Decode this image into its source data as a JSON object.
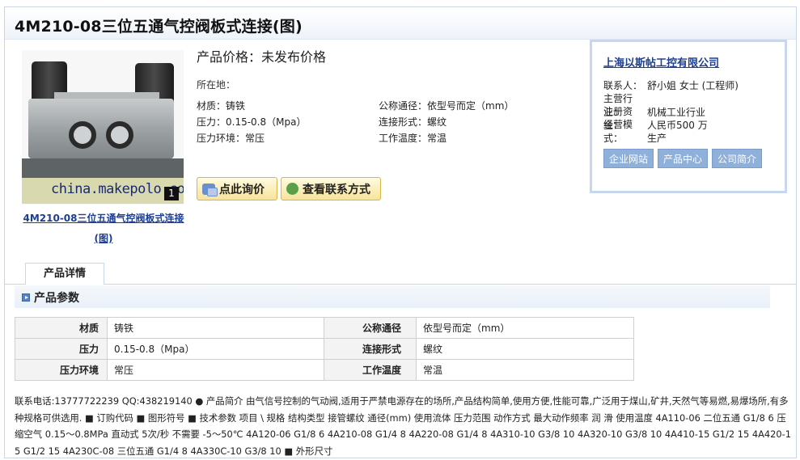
{
  "title": "4M210-08三位五通气控阀板式连接(图)",
  "image": {
    "watermark": "china.makepolo.com",
    "badge": "1",
    "caption": "4M210-08三位五通气控阀板式连接(图)"
  },
  "product": {
    "price_label": "产品价格：",
    "price_value": "未发布价格",
    "location": "所在地：",
    "specs": [
      {
        "label": "材质：铸铁"
      },
      {
        "label": "公称通径：依型号而定（mm）"
      },
      {
        "label": "压力：0.15-0.8（Mpa）"
      },
      {
        "label": "连接形式：螺纹"
      },
      {
        "label": "压力环境：常压"
      },
      {
        "label": "工作温度：常温"
      }
    ],
    "inquiry_button": "点此询价",
    "contact_button": "查看联系方式"
  },
  "company": {
    "name": "上海以斯帖工控有限公司",
    "rows": [
      {
        "key": "联系人：",
        "value": "舒小姐 女士 (工程师)"
      },
      {
        "key": "主营行业：",
        "value": "机械工业行业"
      },
      {
        "key": "注册资金：",
        "value": "人民币500 万"
      },
      {
        "key": "经营模式：",
        "value": "生产"
      }
    ],
    "buttons": [
      "企业网站",
      "产品中心",
      "公司简介"
    ]
  },
  "detail": {
    "tab": "产品详情",
    "section_title": "产品参数",
    "table": [
      [
        "材质",
        "铸铁",
        "公称通径",
        "依型号而定（mm）"
      ],
      [
        "压力",
        "0.15-0.8（Mpa）",
        "连接形式",
        "螺纹"
      ],
      [
        "压力环境",
        "常压",
        "工作温度",
        "常温"
      ]
    ],
    "description": "联系电话:13777722239 QQ:438219140 ● 产品简介 由气信号控制的气动阀,适用于严禁电源存在的场所,产品结构简单,使用方便,性能可靠,广泛用于煤山,矿井,天然气等易燃,易爆场所,有多种规格可供选用. ■ 订购代码 ■ 图形符号 ■ 技术参数 项目 \\ 规格 结构类型 接管螺纹 通径(mm) 使用流体 压力范围 动作方式 最大动作频率 润 滑 使用温度 4A110-06 二位五通 G1/8 6 压缩空气 0.15～0.8MPa 直动式 5次/秒 不需要 -5～50℃ 4A120-06 G1/8 6 4A210-08 G1/4 8 4A220-08 G1/4 8 4A310-10 G3/8 10 4A320-10 G3/8 10 4A410-15 G1/2 15 4A420-15 G1/2 15 4A230C-08 三位五通 G1/4 8 4A330C-10 G3/8 10 ■ 外形尺寸"
  }
}
